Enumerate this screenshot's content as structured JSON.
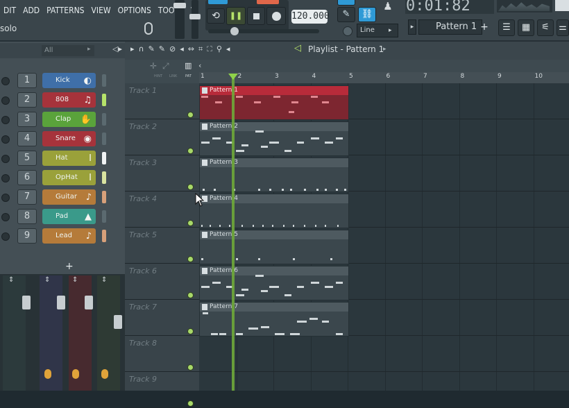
{
  "menu": [
    "DIT",
    "ADD",
    "PATTERNS",
    "VIEW",
    "OPTIONS",
    "TOOLS",
    "?"
  ],
  "hint": "solo",
  "transport": {
    "tempo": "120.000",
    "time": "0:01:82",
    "pattern": "Pattern 1",
    "snap": "Line"
  },
  "rack": {
    "filter": "All",
    "add_label": "+",
    "channels": [
      {
        "num": "1",
        "name": "Kick",
        "color": "#3f6fa8",
        "bar": "#5b6a70",
        "icon": "◐"
      },
      {
        "num": "2",
        "name": "808",
        "color": "#a6333b",
        "bar": "#b6e36a",
        "icon": "♫"
      },
      {
        "num": "3",
        "name": "Clap",
        "color": "#5aa33b",
        "bar": "#5b6a70",
        "icon": "✋"
      },
      {
        "num": "4",
        "name": "Snare",
        "color": "#a6333b",
        "bar": "#5b6a70",
        "icon": "◉"
      },
      {
        "num": "5",
        "name": "Hat",
        "color": "#9aa13a",
        "bar": "#f0f3f4",
        "icon": "I"
      },
      {
        "num": "6",
        "name": "OpHat",
        "color": "#9aa13a",
        "bar": "#d9e3a0",
        "icon": "I"
      },
      {
        "num": "7",
        "name": "Guitar",
        "color": "#b57b3a",
        "bar": "#d7a07a",
        "icon": "♪"
      },
      {
        "num": "8",
        "name": "Pad",
        "color": "#3a9a8a",
        "bar": "#5b6a70",
        "icon": "▲"
      },
      {
        "num": "9",
        "name": "Lead",
        "color": "#b57b3a",
        "bar": "#d7a07a",
        "icon": "♪"
      }
    ]
  },
  "playlist": {
    "title": "Playlist - Pattern 1",
    "header_labels": [
      "HINT",
      "LINK",
      "PAT"
    ],
    "ruler": [
      "1",
      "2",
      "3",
      "4",
      "5",
      "6",
      "7",
      "8",
      "9",
      "10"
    ],
    "tracks": [
      "Track 1",
      "Track 2",
      "Track 3",
      "Track 4",
      "Track 5",
      "Track 6",
      "Track 7",
      "Track 8",
      "Track 9"
    ],
    "clips": [
      {
        "label": "Pattern 1",
        "red": true
      },
      {
        "label": "Pattern 2",
        "red": false
      },
      {
        "label": "Pattern 3",
        "red": false
      },
      {
        "label": "Pattern 4",
        "red": false
      },
      {
        "label": "Pattern 5",
        "red": false
      },
      {
        "label": "Pattern 6",
        "red": false
      },
      {
        "label": "Pattern 7",
        "red": false
      }
    ]
  }
}
